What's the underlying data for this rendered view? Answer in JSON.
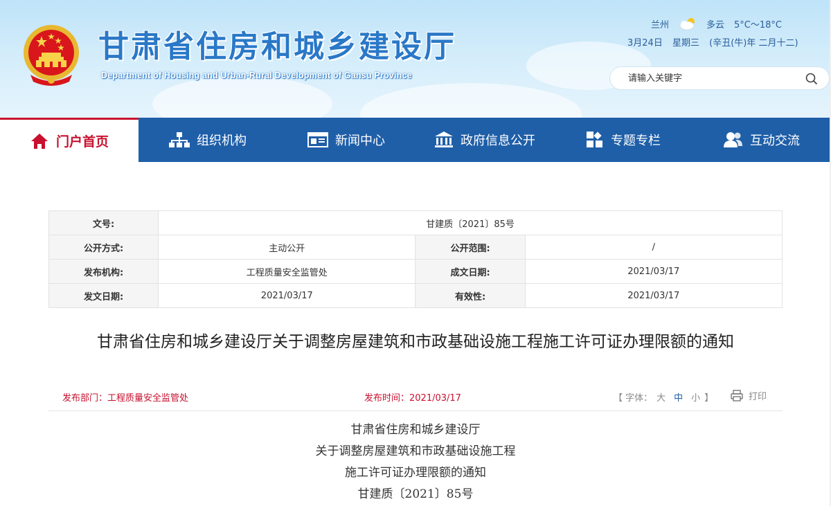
{
  "header": {
    "title": "甘肃省住房和城乡建设厅",
    "subtitle": "Department of Housing and Urban-Rural Development of Gansu Province",
    "weather": {
      "city": "兰州",
      "condition": "多云",
      "temperature": "5°C～18°C"
    },
    "date": {
      "day": "3月24日",
      "weekday": "星期三",
      "lunar": "(辛丑(牛)年 二月十二)"
    },
    "search": {
      "placeholder": "请输入关键字"
    },
    "colors": {
      "title": "#2a78c8",
      "nav": "#1f5fa8",
      "accent": "#c8102e"
    }
  },
  "nav": {
    "items": [
      {
        "label": "门户首页",
        "icon": "home-icon"
      },
      {
        "label": "组织机构",
        "icon": "org-chart-icon"
      },
      {
        "label": "新闻中心",
        "icon": "news-icon"
      },
      {
        "label": "政府信息公开",
        "icon": "government-building-icon"
      },
      {
        "label": "专题专栏",
        "icon": "topics-grid-icon"
      },
      {
        "label": "互动交流",
        "icon": "users-icon"
      }
    ]
  },
  "info": {
    "doc_no_label": "文号:",
    "doc_no": "甘建质〔2021〕85号",
    "disclosure_label": "公开方式:",
    "disclosure": "主动公开",
    "scope_label": "公开范围:",
    "scope": "/",
    "org_label": "发布机构:",
    "org": "工程质量安全监管处",
    "written_label": "成文日期:",
    "written": "2021/03/17",
    "issued_label": "发文日期:",
    "issued": "2021/03/17",
    "validity_label": "有效性:",
    "validity": "2021/03/17"
  },
  "article": {
    "title": "甘肃省住房和城乡建设厅关于调整房屋建筑和市政基础设施工程施工许可证办理限额的通知",
    "dept": "发布部门：工程质量安全监管处",
    "time": "发布时间：2021/03/17",
    "font_label": "【 字体：",
    "font_large": "大",
    "font_medium": "中",
    "font_small": "小",
    "font_end": "】",
    "print_label": "打印",
    "body_lines": [
      "甘肃省住房和城乡建设厅",
      "关于调整房屋建筑和市政基础设施工程",
      "施工许可证办理限额的通知",
      "甘建质〔2021〕85号"
    ]
  }
}
